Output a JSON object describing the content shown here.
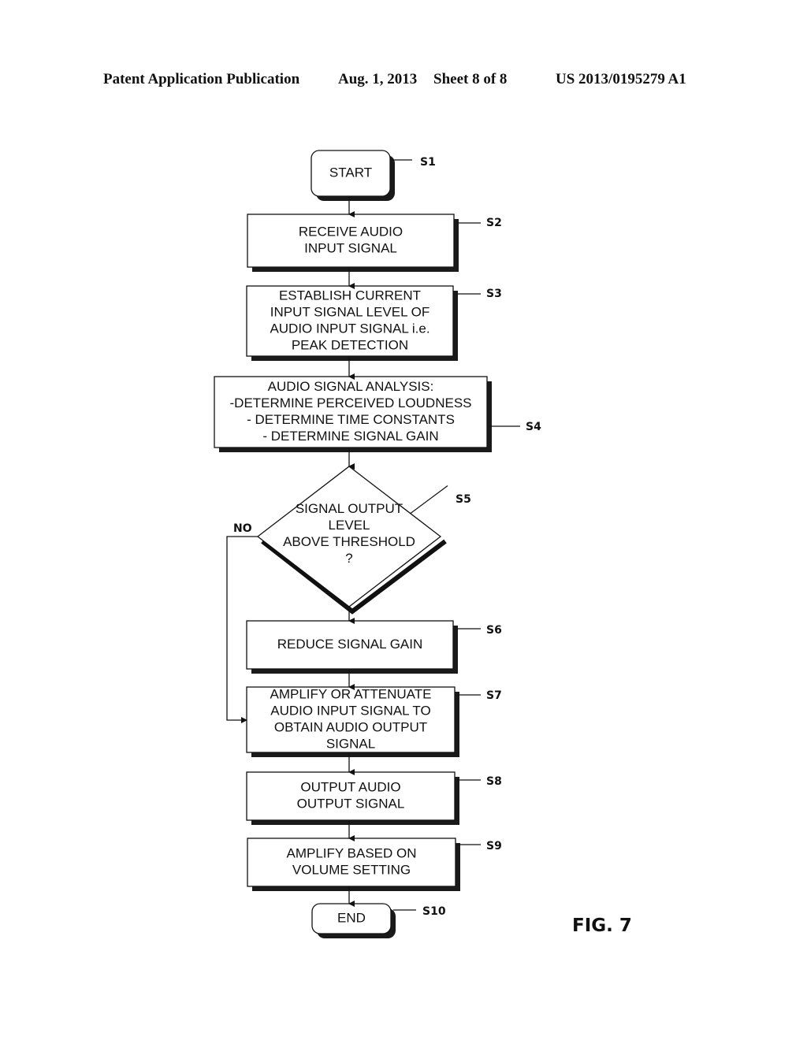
{
  "header": {
    "publication": "Patent Application Publication",
    "date": "Aug. 1, 2013",
    "sheet": "Sheet 8 of 8",
    "number": "US 2013/0195279 A1"
  },
  "figure_label": "FIG. 7",
  "steps": [
    {
      "id": "S1",
      "type": "terminal",
      "lines": [
        "START"
      ]
    },
    {
      "id": "S2",
      "type": "process",
      "lines": [
        "RECEIVE  AUDIO",
        "INPUT SIGNAL"
      ]
    },
    {
      "id": "S3",
      "type": "process",
      "lines": [
        "ESTABLISH CURRENT",
        "INPUT SIGNAL LEVEL OF",
        "AUDIO INPUT SIGNAL i.e.",
        "PEAK DETECTION"
      ]
    },
    {
      "id": "S4",
      "type": "process",
      "lines": [
        "AUDIO SIGNAL  ANALYSIS:",
        "-DETERMINE PERCEIVED LOUDNESS",
        "- DETERMINE TIME CONSTANTS",
        "- DETERMINE SIGNAL GAIN"
      ]
    },
    {
      "id": "S5",
      "type": "decision",
      "lines": [
        "SIGNAL OUTPUT",
        "LEVEL",
        "ABOVE THRESHOLD",
        "?"
      ]
    },
    {
      "id": "S6",
      "type": "process",
      "lines": [
        "REDUCE SIGNAL GAIN"
      ]
    },
    {
      "id": "S7",
      "type": "process",
      "lines": [
        "AMPLIFY OR ATTENUATE",
        "AUDIO INPUT SIGNAL TO",
        "OBTAIN AUDIO OUTPUT",
        "SIGNAL"
      ]
    },
    {
      "id": "S8",
      "type": "process",
      "lines": [
        "OUTPUT AUDIO",
        "OUTPUT SIGNAL"
      ]
    },
    {
      "id": "S9",
      "type": "process",
      "lines": [
        "AMPLIFY BASED ON",
        "VOLUME SETTING"
      ]
    },
    {
      "id": "S10",
      "type": "terminal",
      "lines": [
        "END"
      ]
    }
  ],
  "branch_label": "NO"
}
